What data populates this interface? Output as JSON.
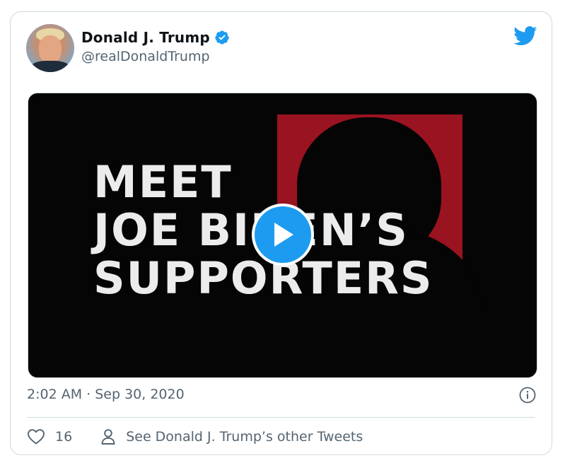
{
  "tweet": {
    "author": {
      "display_name": "Donald J. Trump",
      "handle": "@realDonaldTrump",
      "verified": true
    },
    "media": {
      "type": "video",
      "overlay_text": [
        "MEET",
        "JOE BIDEN’S",
        "SUPPORTERS"
      ]
    },
    "timestamp": "2:02 AM · Sep 30, 2020",
    "likes": "16",
    "other_tweets_label": "See Donald J. Trump’s other Tweets"
  },
  "colors": {
    "accent": "#1d9bf0",
    "text_primary": "#0f1419",
    "text_secondary": "#536471",
    "border": "#cfd9de",
    "video_red": "#9a1320"
  },
  "icons": {
    "brand": "twitter-bird-icon",
    "verified": "verified-badge-icon",
    "play": "play-icon",
    "info": "info-icon",
    "like": "heart-icon",
    "profile": "person-icon"
  }
}
